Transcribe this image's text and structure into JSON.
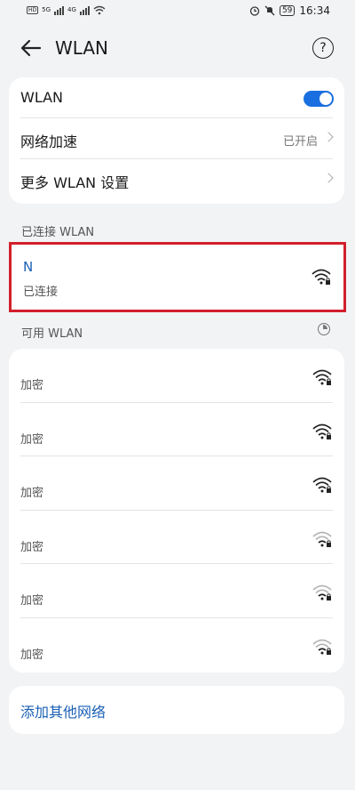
{
  "status_bar": {
    "sim_label": "HD",
    "network_type_1": "5G",
    "network_type_2": "4G",
    "battery": "59",
    "time": "16:34"
  },
  "header": {
    "title": "WLAN",
    "help_label": "?"
  },
  "settings": {
    "wlan_label": "WLAN",
    "wlan_enabled": true,
    "network_boost_label": "网络加速",
    "network_boost_value": "已开启",
    "more_settings_label": "更多 WLAN 设置"
  },
  "connected": {
    "header": "已连接 WLAN",
    "network": {
      "name": "N",
      "status": "已连接"
    }
  },
  "available": {
    "header": "可用 WLAN",
    "networks": [
      {
        "status": "加密",
        "signal": "strong"
      },
      {
        "status": "加密",
        "signal": "strong"
      },
      {
        "status": "加密",
        "signal": "strong"
      },
      {
        "status": "加密",
        "signal": "weak"
      },
      {
        "status": "加密",
        "signal": "weak"
      },
      {
        "status": "加密",
        "signal": "weak"
      }
    ]
  },
  "add_network": {
    "label": "添加其他网络"
  },
  "colors": {
    "accent": "#1a6fe0",
    "link": "#1a5fb4",
    "highlight_border": "#d21f2c"
  }
}
